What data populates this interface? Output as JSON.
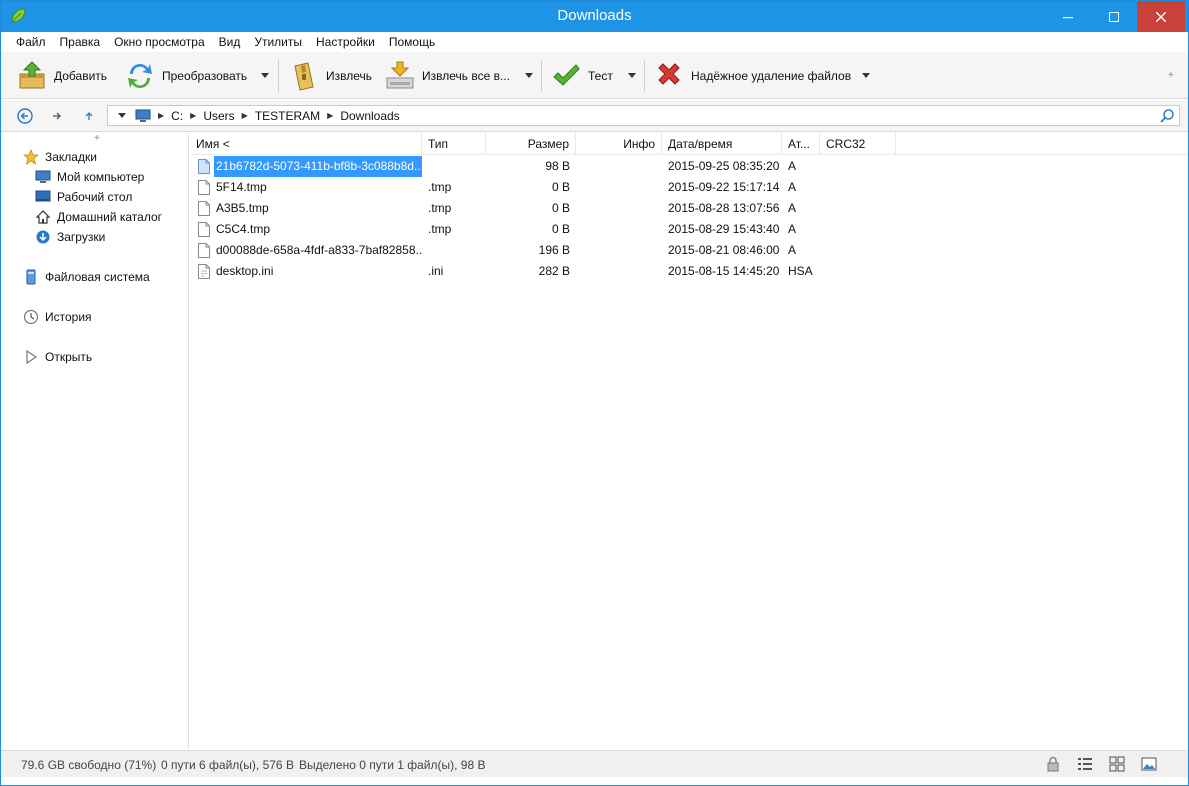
{
  "window": {
    "title": "Downloads"
  },
  "menu": [
    "Файл",
    "Правка",
    "Окно просмотра",
    "Вид",
    "Утилиты",
    "Настройки",
    "Помощь"
  ],
  "toolbar": {
    "add": "Добавить",
    "convert": "Преобразовать",
    "extract": "Извлечь",
    "extract_all": "Извлечь все в...",
    "test": "Тест",
    "secure_delete": "Надёжное удаление файлов"
  },
  "path": {
    "crumbs": [
      "C:",
      "Users",
      "TESTERAM",
      "Downloads"
    ]
  },
  "sidebar": {
    "bookmarks": "Закладки",
    "items": [
      "Мой компьютер",
      "Рабочий стол",
      "Домашний каталог",
      "Загрузки"
    ],
    "filesystem": "Файловая система",
    "history": "История",
    "open": "Открыть"
  },
  "columns": {
    "name": "Имя <",
    "type": "Тип",
    "size": "Размер",
    "info": "Инфо",
    "date": "Дата/время",
    "attr": "Ат...",
    "crc": "CRC32"
  },
  "files": [
    {
      "name": "21b6782d-5073-411b-bf8b-3c088b8d...",
      "type": "",
      "size": "98 B",
      "date": "2015-09-25 08:35:20",
      "attr": "A",
      "selected": true
    },
    {
      "name": "5F14.tmp",
      "type": ".tmp",
      "size": "0 B",
      "date": "2015-09-22 15:17:14",
      "attr": "A"
    },
    {
      "name": "A3B5.tmp",
      "type": ".tmp",
      "size": "0 B",
      "date": "2015-08-28 13:07:56",
      "attr": "A"
    },
    {
      "name": "C5C4.tmp",
      "type": ".tmp",
      "size": "0 B",
      "date": "2015-08-29 15:43:40",
      "attr": "A"
    },
    {
      "name": "d00088de-658a-4fdf-a833-7baf82858...",
      "type": "",
      "size": "196 B",
      "date": "2015-08-21 08:46:00",
      "attr": "A"
    },
    {
      "name": "desktop.ini",
      "type": ".ini",
      "size": "282 B",
      "date": "2015-08-15 14:45:20",
      "attr": "HSA"
    }
  ],
  "status": {
    "free": "79.6 GB свободно (71%)",
    "totals": "0 пути 6 файл(ы), 576 B",
    "selected": "Выделено 0 пути 1 файл(ы), 98 B"
  },
  "colors": {
    "titlebar": "#1e94e6",
    "selection": "#3399ff",
    "close": "#c8423a"
  }
}
